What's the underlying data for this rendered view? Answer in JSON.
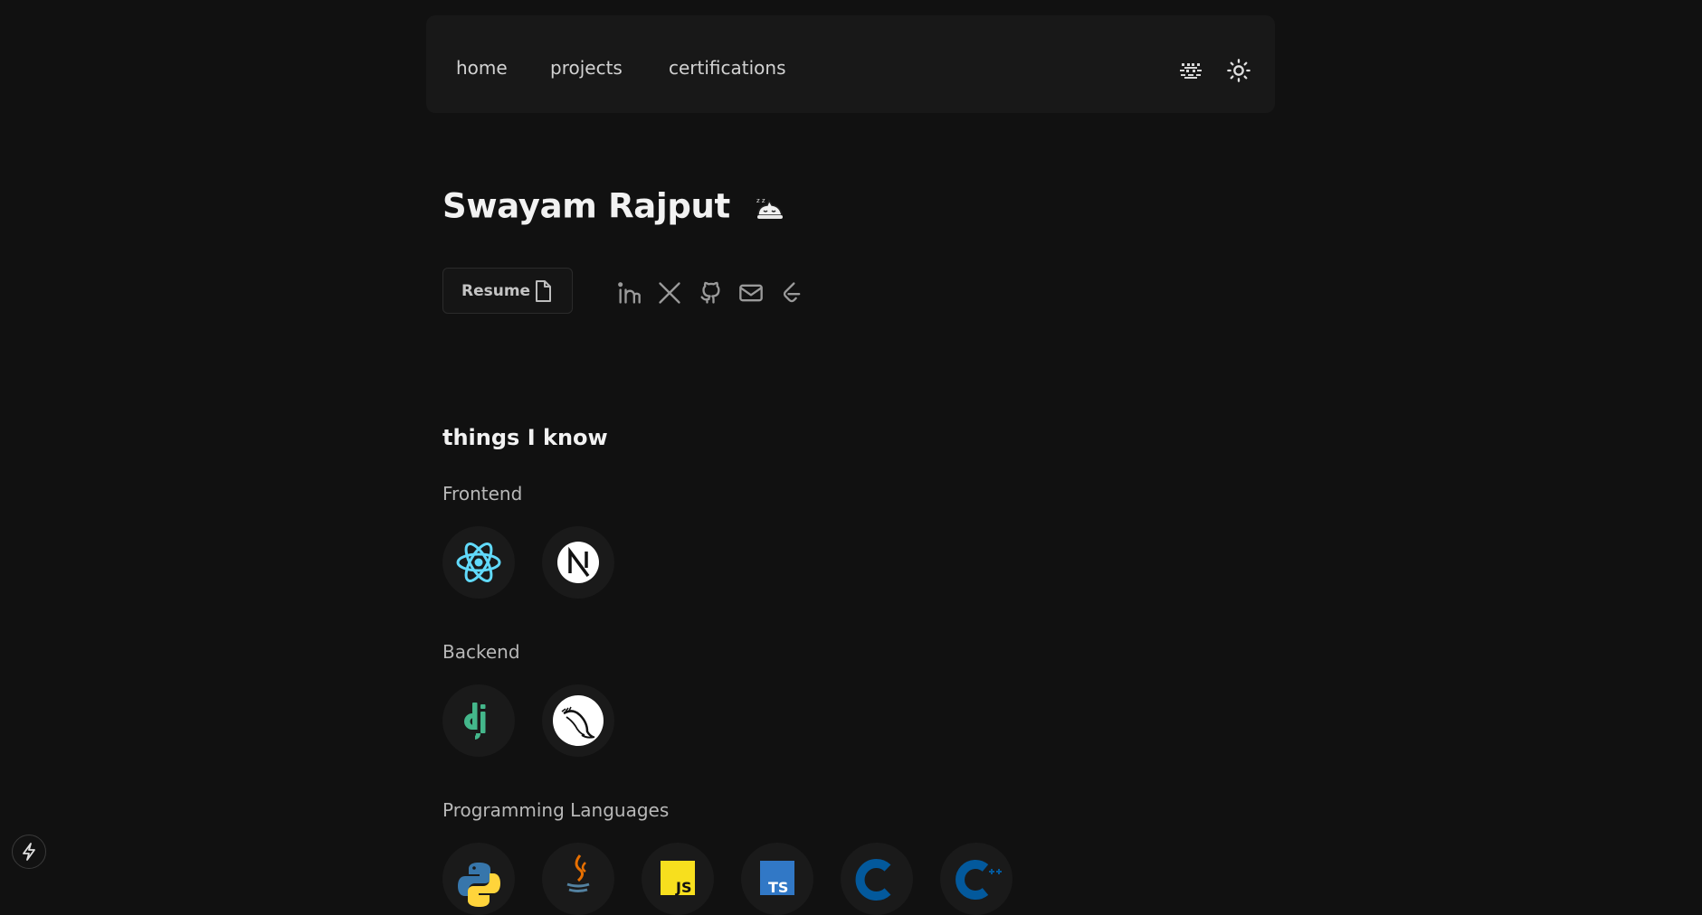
{
  "nav": {
    "links": [
      "home",
      "projects",
      "certifications"
    ],
    "icons": {
      "left": "cat-pixel-icon",
      "right": "sun-icon"
    }
  },
  "hero": {
    "name": "Swayam Rajput",
    "wave_icon": "sleeping-cat-icon",
    "resume_label": "Resume",
    "resume_icon": "document-icon",
    "socials": [
      "linkedin-icon",
      "x-icon",
      "github-icon",
      "mail-icon",
      "leetcode-icon"
    ]
  },
  "skills": {
    "title": "things I know",
    "categories": [
      {
        "name": "Frontend",
        "items": [
          "react-icon",
          "nextjs-icon"
        ]
      },
      {
        "name": "Backend",
        "items": [
          "django-icon",
          "flask-icon"
        ]
      },
      {
        "name": "Programming Languages",
        "items": [
          "python-icon",
          "java-icon",
          "javascript-icon",
          "typescript-icon",
          "c-icon",
          "cpp-icon"
        ]
      }
    ]
  },
  "floating": {
    "icon": "bolt-icon"
  },
  "colors": {
    "background": "#111111",
    "nav_bg": "#181818",
    "tile_bg": "#1a1a1a",
    "react": "#61dafb",
    "django": "#44b78b",
    "js_yellow": "#f7df1e",
    "ts_blue": "#3178c6",
    "c_blue": "#03599c"
  },
  "badges": {
    "javascript": "JS",
    "typescript": "TS"
  }
}
